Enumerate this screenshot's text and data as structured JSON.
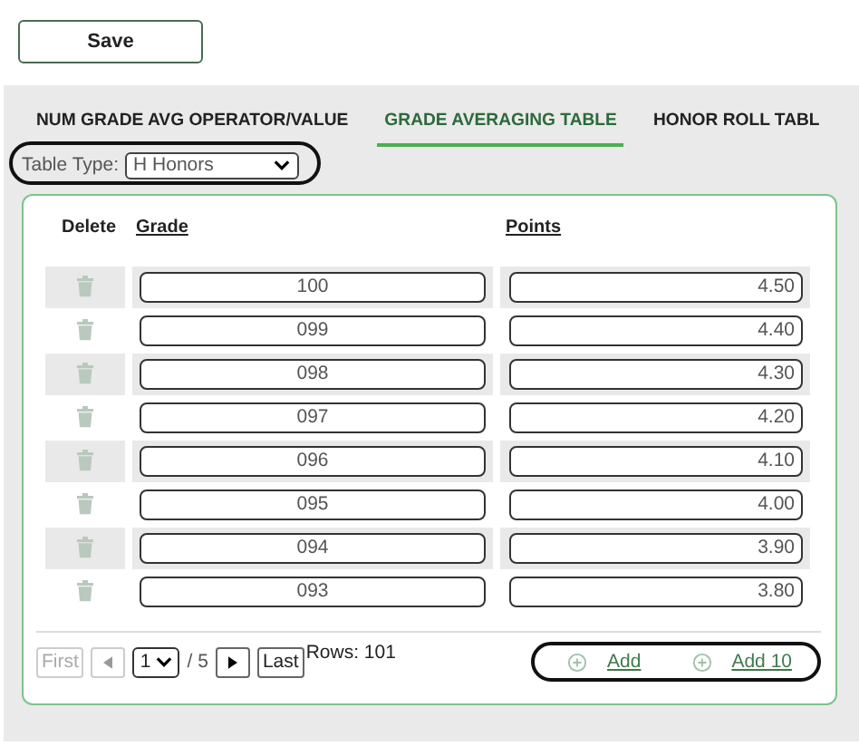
{
  "toolbar": {
    "save_button": "Save"
  },
  "tabs": [
    {
      "label": "NUM GRADE AVG OPERATOR/VALUE",
      "selected": false
    },
    {
      "label": "GRADE AVERAGING TABLE",
      "selected": true
    },
    {
      "label": "HONOR ROLL TABL",
      "selected": false
    }
  ],
  "table_type": {
    "label": "Table Type:",
    "value": "H Honors",
    "highlighted": true
  },
  "table": {
    "columns": [
      "Delete",
      "Grade",
      "Points"
    ],
    "rows": [
      {
        "grade": "100",
        "points": "4.50"
      },
      {
        "grade": "099",
        "points": "4.40"
      },
      {
        "grade": "098",
        "points": "4.30"
      },
      {
        "grade": "097",
        "points": "4.20"
      },
      {
        "grade": "096",
        "points": "4.10"
      },
      {
        "grade": "095",
        "points": "4.00"
      },
      {
        "grade": "094",
        "points": "3.90"
      },
      {
        "grade": "093",
        "points": "3.80"
      }
    ]
  },
  "pager": {
    "first": {
      "label": "First",
      "disabled": true
    },
    "prev": {
      "disabled": true
    },
    "page": "1",
    "of": "/ 5",
    "next": {
      "disabled": false
    },
    "last": {
      "label": "Last",
      "disabled": false
    },
    "rows": "Rows: 101"
  },
  "add_links": {
    "items": [
      "Add",
      "Add 10"
    ],
    "highlighted": true
  }
}
